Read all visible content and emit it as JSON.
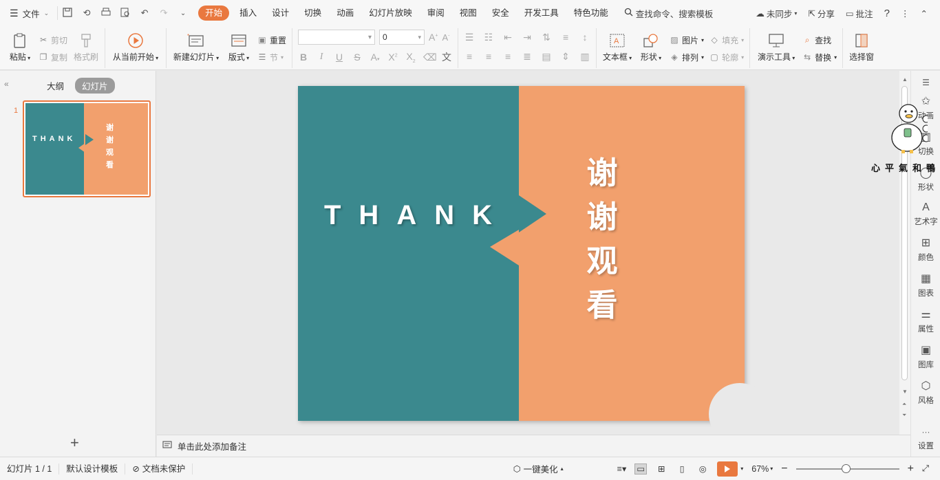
{
  "menubar": {
    "file_label": "文件",
    "tabs": [
      "开始",
      "插入",
      "设计",
      "切换",
      "动画",
      "幻灯片放映",
      "审阅",
      "视图",
      "安全",
      "开发工具",
      "特色功能"
    ],
    "active_tab": "开始",
    "search_label": "查找命令、搜索模板",
    "sync_label": "未同步",
    "share_label": "分享",
    "comment_label": "批注"
  },
  "ribbon": {
    "paste": "粘贴",
    "cut": "剪切",
    "copy": "复制",
    "format_painter": "格式刷",
    "from_current": "从当前开始",
    "new_slide": "新建幻灯片",
    "layout": "版式",
    "reset": "重置",
    "section": "节",
    "font_size": "0",
    "text_box": "文本框",
    "shape": "形状",
    "picture": "图片",
    "fill": "填充",
    "arrange": "排列",
    "outline": "轮廓",
    "present_tools": "演示工具",
    "find": "查找",
    "replace": "替换",
    "select_pane": "选择窗"
  },
  "leftpanel": {
    "tab_outline": "大纲",
    "tab_slides": "幻灯片",
    "slide_number": "1",
    "thumb_word": "THANK",
    "thumb_cn": "谢谢观看"
  },
  "slide": {
    "word": "THANK",
    "cn_lines": [
      "谢",
      "谢",
      "观",
      "看"
    ],
    "colors": {
      "teal": "#3b898e",
      "orange": "#f2a06d"
    }
  },
  "sidebar": {
    "items": [
      "动画",
      "切换",
      "形状",
      "艺术字",
      "颜色",
      "图表",
      "属性",
      "图库",
      "风格",
      "设置"
    ]
  },
  "stamp_text": "心平氣和鴨",
  "notes_placeholder": "单击此处添加备注",
  "status": {
    "slide_count": "幻灯片 1 / 1",
    "template": "默认设计模板",
    "protection": "文档未保护",
    "beautify": "一键美化",
    "zoom": "67%"
  },
  "colors": {
    "accent": "#e9783f"
  }
}
